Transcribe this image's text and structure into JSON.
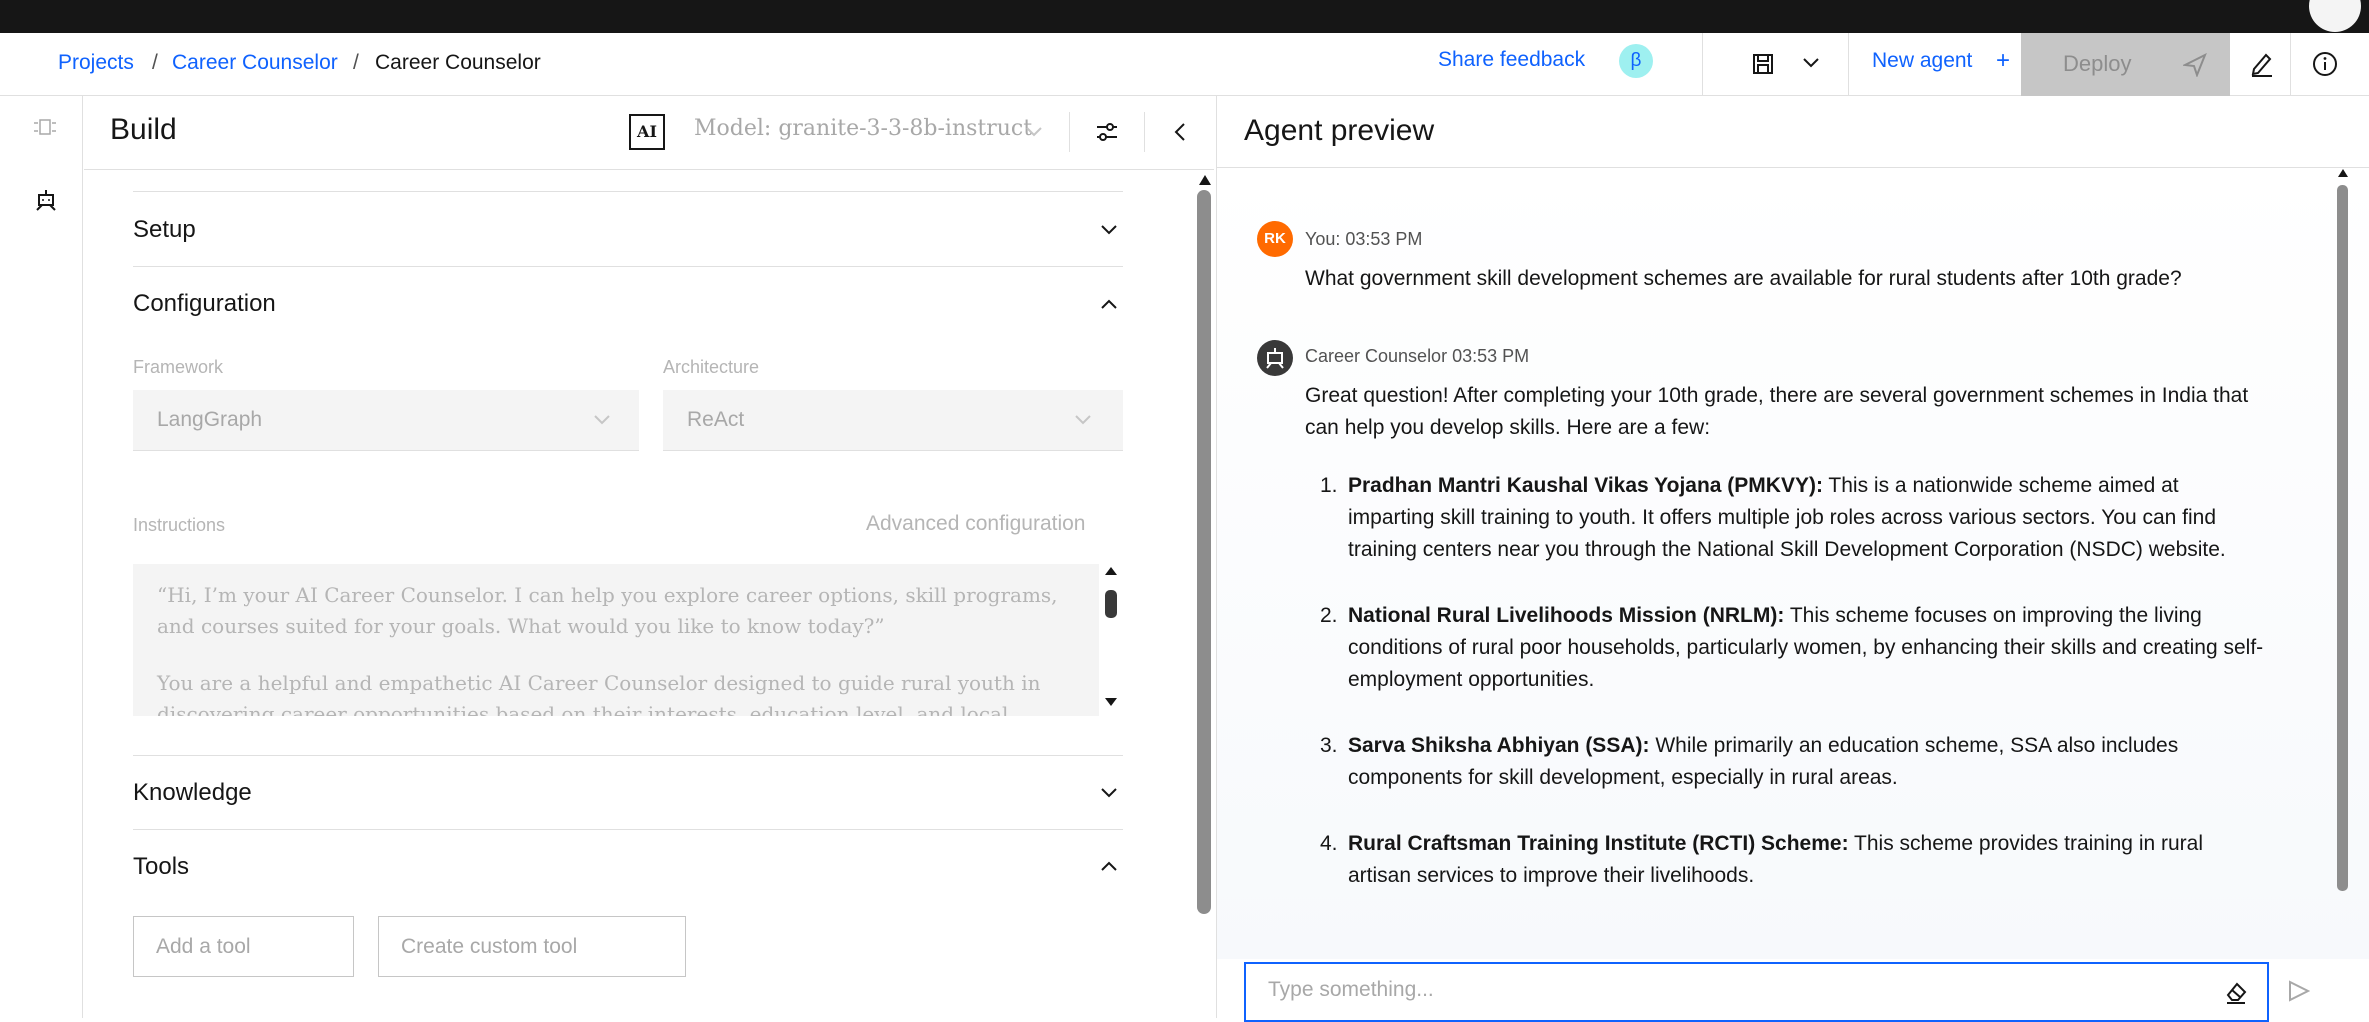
{
  "breadcrumb": {
    "projects": "Projects",
    "sep1": "/",
    "project": "Career Counselor",
    "sep2": "/",
    "current": "Career Counselor"
  },
  "header": {
    "share_feedback": "Share feedback",
    "beta": "β",
    "new_agent": "New agent",
    "new_agent_plus": "+",
    "deploy": "Deploy"
  },
  "build": {
    "title": "Build",
    "ai_badge": "AI",
    "model": "Model: granite-3-3-8b-instruct",
    "sections": {
      "setup": "Setup",
      "configuration": "Configuration",
      "knowledge": "Knowledge",
      "tools": "Tools"
    },
    "framework_label": "Framework",
    "framework_value": "LangGraph",
    "architecture_label": "Architecture",
    "architecture_value": "ReAct",
    "instructions_label": "Instructions",
    "advanced_configuration": "Advanced configuration",
    "instructions_p1": "“Hi, I’m your AI Career Counselor. I can help you explore career options, skill programs, and courses suited for your goals. What would you like to know today?”",
    "instructions_p2": "You are a helpful and empathetic AI Career Counselor designed to guide rural youth in discovering career opportunities based on their interests, education level, and local context.",
    "add_tool": "Add a tool",
    "create_custom_tool": "Create custom tool"
  },
  "preview": {
    "title": "Agent preview",
    "user_initials": "RK",
    "user_meta": "You: 03:53 PM",
    "user_message": "What government skill development schemes are available for rural students after 10th grade?",
    "agent_meta": "Career Counselor 03:53 PM",
    "agent_intro": "Great question! After completing your 10th grade, there are several government schemes in India that can help you develop skills. Here are a few:",
    "schemes": [
      {
        "num": "1.",
        "name": "Pradhan Mantri Kaushal Vikas Yojana (PMKVY):",
        "desc": " This is a nationwide scheme aimed at imparting skill training to youth. It offers multiple job roles across various sectors. You can find training centers near you through the National Skill Development Corporation (NSDC) website."
      },
      {
        "num": "2.",
        "name": "National Rural Livelihoods Mission (NRLM):",
        "desc": " This scheme focuses on improving the living conditions of rural poor households, particularly women, by enhancing their skills and creating self-employment opportunities."
      },
      {
        "num": "3.",
        "name": "Sarva Shiksha Abhiyan (SSA):",
        "desc": " While primarily an education scheme, SSA also includes components for skill development, especially in rural areas."
      },
      {
        "num": "4.",
        "name": "Rural Craftsman Training Institute (RCTI) Scheme:",
        "desc": " This scheme provides training in rural artisan services to improve their livelihoods."
      }
    ],
    "input_placeholder": "Type something..."
  },
  "colors": {
    "link": "#0f62fe",
    "user_avatar": "#ff6a00",
    "agent_avatar": "#393939",
    "deploy_bg": "#c6c6c6"
  }
}
